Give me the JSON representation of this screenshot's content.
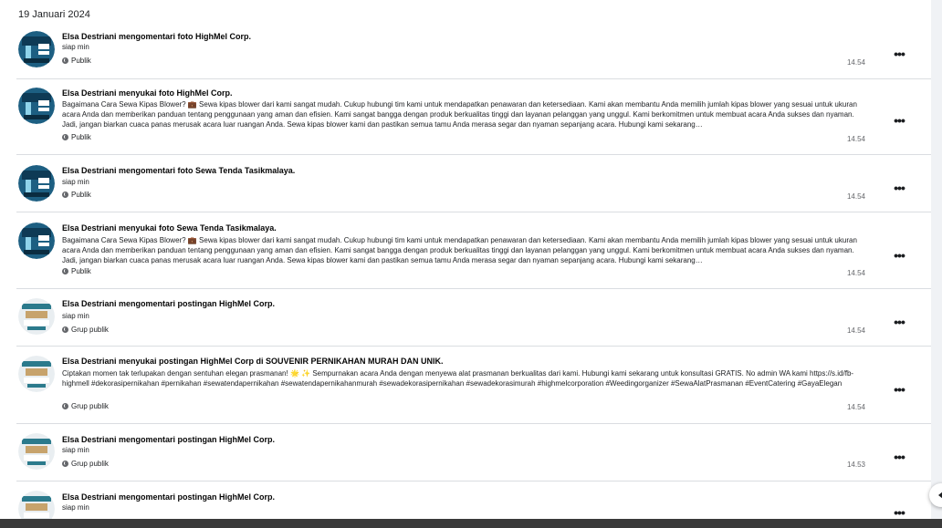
{
  "date_header": "19 Januari 2024",
  "entries": [
    {
      "title": "Elsa Destriani mengomentari foto HighMel Corp.",
      "sub": "siap min",
      "body": "",
      "privacy": "Publik",
      "time": "14.54",
      "avatar": "tent"
    },
    {
      "title": "Elsa Destriani menyukai foto HighMel Corp.",
      "sub": "",
      "body": "Bagaimana Cara Sewa Kipas Blower? 💼 Sewa kipas blower dari kami sangat mudah. Cukup hubungi tim kami untuk mendapatkan penawaran dan ketersediaan. Kami akan membantu Anda memilih jumlah kipas blower yang sesuai untuk ukuran acara Anda dan memberikan panduan tentang penggunaan yang aman dan efisien. Kami sangat bangga dengan produk berkualitas tinggi dan layanan pelanggan yang unggul. Kami berkomitmen untuk membuat acara Anda sukses dan nyaman. Jadi, jangan biarkan cuaca panas merusak acara luar ruangan Anda. Sewa kipas blower kami dan pastikan semua tamu Anda merasa segar dan nyaman sepanjang acara. Hubungi kami sekarang…",
      "privacy": "Publik",
      "time": "14.54",
      "avatar": "tent"
    },
    {
      "title": "Elsa Destriani mengomentari foto Sewa Tenda Tasikmalaya.",
      "sub": "siap min",
      "body": "",
      "privacy": "Publik",
      "time": "14.54",
      "avatar": "tent"
    },
    {
      "title": "Elsa Destriani menyukai foto Sewa Tenda Tasikmalaya.",
      "sub": "",
      "body": "Bagaimana Cara Sewa Kipas Blower? 💼 Sewa kipas blower dari kami sangat mudah. Cukup hubungi tim kami untuk mendapatkan penawaran dan ketersediaan. Kami akan membantu Anda memilih jumlah kipas blower yang sesuai untuk ukuran acara Anda dan memberikan panduan tentang penggunaan yang aman dan efisien. Kami sangat bangga dengan produk berkualitas tinggi dan layanan pelanggan yang unggul. Kami berkomitmen untuk membuat acara Anda sukses dan nyaman. Jadi, jangan biarkan cuaca panas merusak acara luar ruangan Anda. Sewa kipas blower kami dan pastikan semua tamu Anda merasa segar dan nyaman sepanjang acara. Hubungi kami sekarang…",
      "privacy": "Publik",
      "time": "14.54",
      "avatar": "tent"
    },
    {
      "title": "Elsa Destriani mengomentari postingan HighMel Corp.",
      "sub": "siap min",
      "body": "",
      "privacy": "Grup publik",
      "time": "14.54",
      "avatar": "souvenir"
    },
    {
      "title": "Elsa Destriani menyukai postingan HighMel Corp di SOUVENIR PERNIKAHAN MURAH DAN UNIK.",
      "sub": "",
      "body": "Ciptakan momen tak terlupakan dengan sentuhan elegan prasmanan! 🌟 ✨ Sempurnakan acara Anda dengan menyewa alat prasmanan berkualitas dari kami. Hubungi kami sekarang untuk konsultasi GRATIS. No admin WA kami https://s.id/fb-highmell #dekorasipernikahan #pernikahan #sewatendapernikahan #sewatendapernikahanmurah #sewadekorasipernikahan #sewadekorasimurah #highmelcorporation #Weedingorganizer #SewaAlatPrasmanan #EventCatering #GayaElegan",
      "privacy": "Grup publik",
      "time": "14.54",
      "avatar": "souvenir"
    },
    {
      "title": "Elsa Destriani mengomentari postingan HighMel Corp.",
      "sub": "siap min",
      "body": "",
      "privacy": "Grup publik",
      "time": "14.53",
      "avatar": "souvenir"
    },
    {
      "title": "Elsa Destriani mengomentari postingan HighMel Corp.",
      "sub": "siap min",
      "body": "",
      "privacy": "",
      "time": "",
      "avatar": "souvenir"
    }
  ],
  "more_label": "•••",
  "globe_icon": "globe-icon",
  "colors": {
    "text": "#050505",
    "secondary": "#65676b",
    "divider": "#dadde1",
    "page_bg": "#f0f2f5"
  }
}
